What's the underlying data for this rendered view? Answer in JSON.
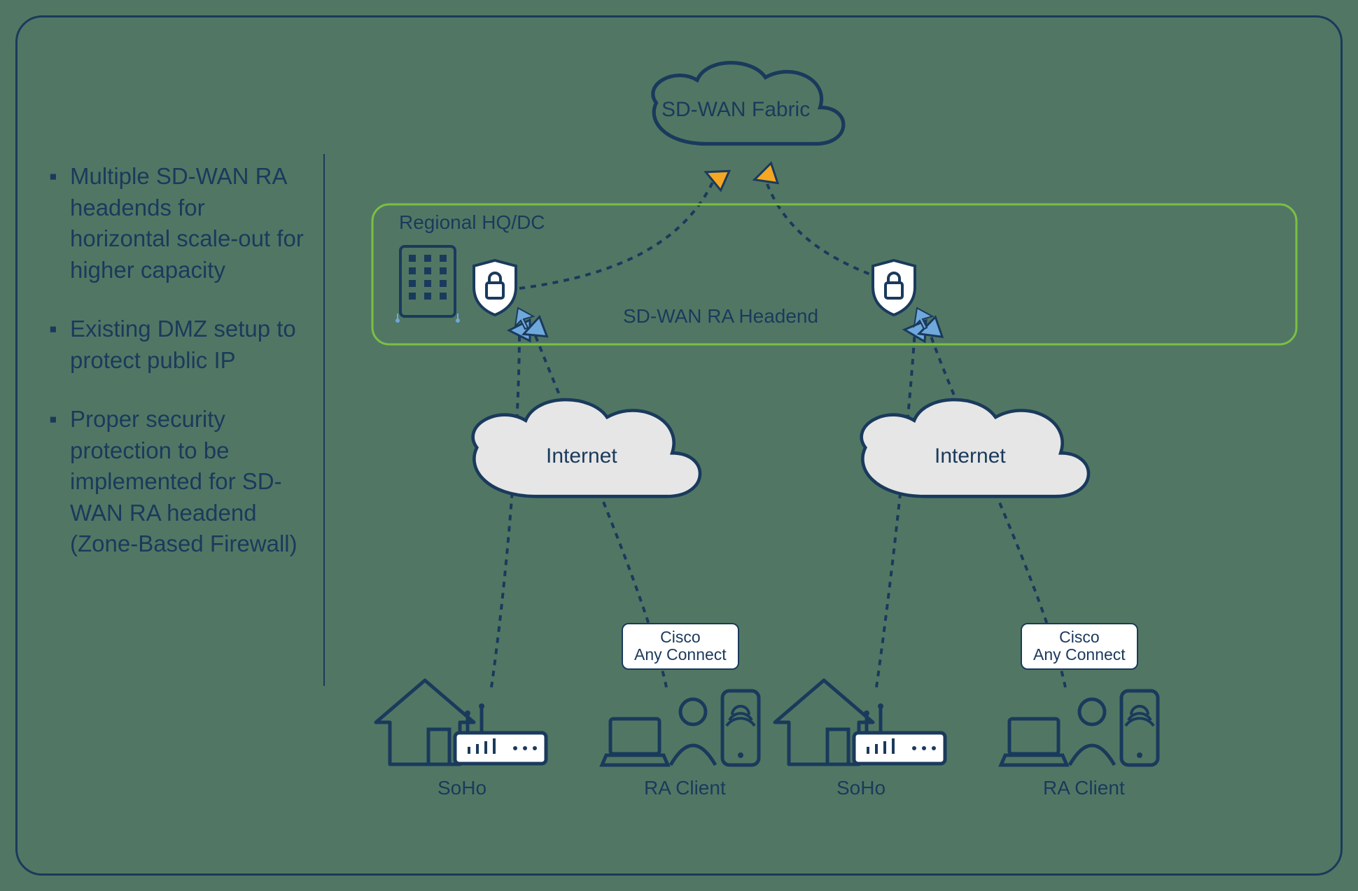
{
  "bullets": {
    "item1": "Multiple SD-WAN RA headends for horizontal scale-out for higher capacity",
    "item2": "Existing DMZ setup to protect public IP",
    "item3": "Proper security protection to be implemented for SD-WAN RA headend (Zone-Based Firewall)"
  },
  "diagram": {
    "fabric_label": "SD-WAN Fabric",
    "regional_label": "Regional HQ/DC",
    "headend_label": "SD-WAN RA Headend",
    "internet1": "Internet",
    "internet2": "Internet",
    "soho1": "SoHo",
    "soho2": "SoHo",
    "raclient1": "RA Client",
    "raclient2": "RA Client",
    "badge1_line1": "Cisco",
    "badge1_line2": "Any Connect",
    "badge2_line1": "Cisco",
    "badge2_line2": "Any Connect"
  }
}
